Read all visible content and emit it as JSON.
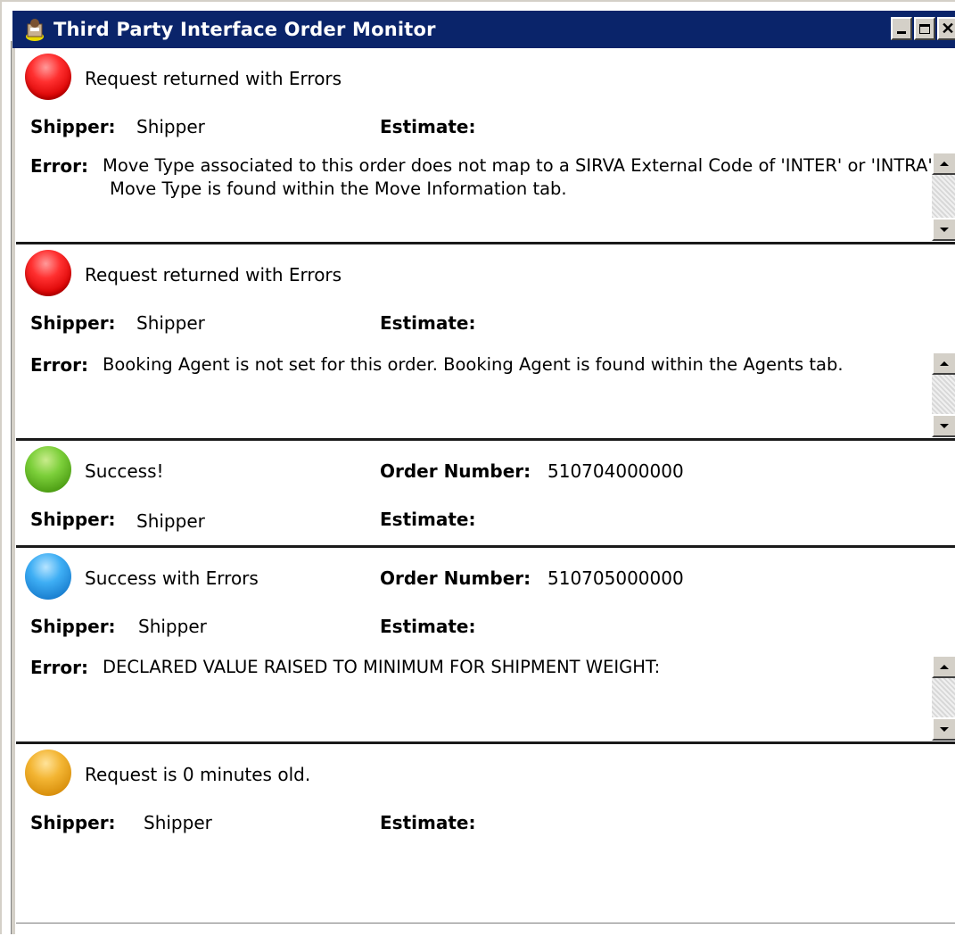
{
  "window": {
    "title": "Third Party Interface Order Monitor",
    "icons": {
      "app": "app-icon",
      "minimize": "minimize-icon",
      "maximize": "maximize-icon",
      "close": "close-icon"
    }
  },
  "labels": {
    "shipper": "Shipper:",
    "estimate": "Estimate:",
    "error": "Error:",
    "order_number": "Order Number:"
  },
  "panels": [
    {
      "status": "Request returned with Errors",
      "status_color": "#ff2020",
      "shipper": "Shipper",
      "error_line1": "Move Type associated to this order does not map to a SIRVA External Code of 'INTER' or 'INTRA'.",
      "error_line2": "Move Type is found within the Move Information tab."
    },
    {
      "status": "Request returned with Errors",
      "status_color": "#ff2020",
      "shipper": "Shipper",
      "error_line1": "Booking Agent is not set for this order.  Booking Agent is found within the Agents tab."
    },
    {
      "status": "Success!",
      "status_color": "#66bb22",
      "shipper": "Shipper",
      "order_number": "510704000000"
    },
    {
      "status": "Success with Errors",
      "status_color": "#2a9be8",
      "shipper": "Shipper",
      "order_number": "510705000000",
      "error_line1": "DECLARED VALUE RAISED TO MINIMUM FOR SHIPMENT WEIGHT:"
    },
    {
      "status": "Request is 0 minutes old.",
      "status_color": "#eba520",
      "shipper": "Shipper"
    }
  ]
}
